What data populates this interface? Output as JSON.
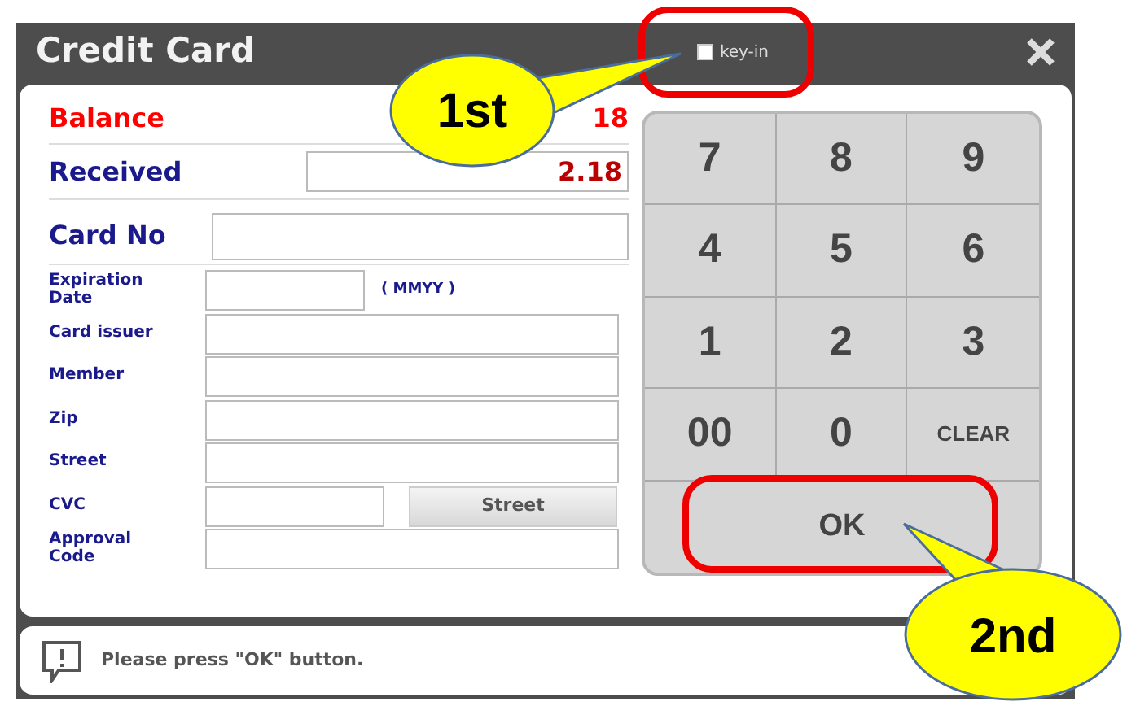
{
  "window": {
    "title": "Credit Card",
    "key_in": {
      "label": "key-in",
      "checked": false
    }
  },
  "form": {
    "balance": {
      "label": "Balance",
      "value": "18"
    },
    "received": {
      "label": "Received",
      "value": "2.18"
    },
    "card_no": {
      "label": "Card No"
    },
    "fields": [
      {
        "label": "Expiration Date",
        "kind": "short",
        "hint": "( MMYY )"
      },
      {
        "label": "Card issuer",
        "kind": "full"
      },
      {
        "label": "Member",
        "kind": "full"
      },
      {
        "label": "Zip",
        "kind": "full"
      },
      {
        "label": "Street",
        "kind": "full"
      },
      {
        "label": "CVC",
        "kind": "button",
        "button": "Street"
      },
      {
        "label": "Approval Code",
        "kind": "full"
      }
    ]
  },
  "keypad": {
    "keys": [
      "7",
      "8",
      "9",
      "4",
      "5",
      "6",
      "1",
      "2",
      "3",
      "00",
      "0",
      "CLEAR"
    ],
    "ok": "OK"
  },
  "status_bar": {
    "message": "Please press \"OK\" button."
  },
  "annotations": [
    {
      "label": "1st",
      "kind": "upper"
    },
    {
      "label": "2nd",
      "kind": "lower"
    }
  ]
}
